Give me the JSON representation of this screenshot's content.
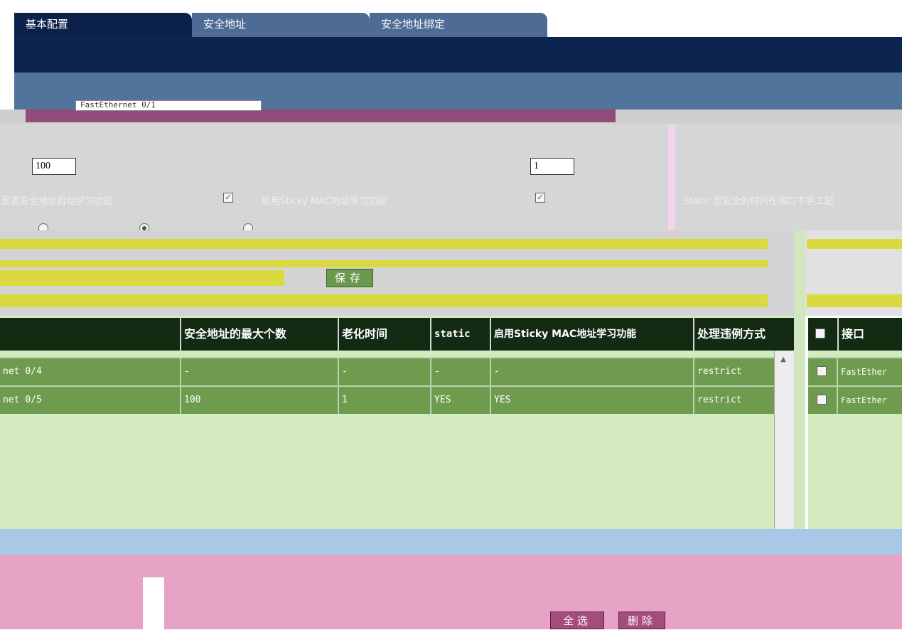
{
  "tabs": [
    "基本配置",
    "安全地址",
    "安全地址绑定"
  ],
  "config": {
    "interface_value": "FastEthernet 0/1",
    "max_count_value": "100",
    "aging_value": "1",
    "label_static": "是否安全地址自动学习功能",
    "label_sticky": "启用Sticky MAC地址学习功能",
    "label_right": "Static 后安全的时间在端口下手工配"
  },
  "buttons": {
    "save": "保存",
    "select_all": "全选",
    "delete": "删除"
  },
  "table": {
    "headers": [
      "安全地址的最大个数",
      "老化时间",
      "static",
      "启用Sticky MAC地址学习功能",
      "处理违例方式"
    ],
    "rows": [
      {
        "port": "net 0/4",
        "max": "-",
        "aging": "-",
        "static": "-",
        "sticky": "-",
        "violation": "restrict"
      },
      {
        "port": "net 0/5",
        "max": "100",
        "aging": "1",
        "static": "YES",
        "sticky": "YES",
        "violation": "restrict"
      }
    ]
  },
  "right_table": {
    "header": "接口",
    "rows": [
      "FastEther",
      "FastEther"
    ]
  },
  "colors": {
    "tab_active": "#0b2149",
    "tab_inactive": "#4d6b94",
    "table_header": "#122b12",
    "table_row": "#6e9b4e"
  }
}
